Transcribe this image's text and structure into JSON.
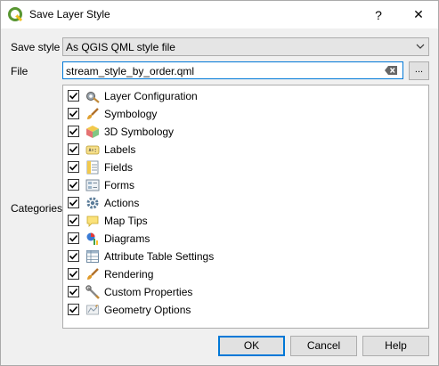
{
  "window": {
    "title": "Save Layer Style",
    "help_glyph": "?",
    "close_glyph": "✕"
  },
  "form": {
    "save_style_label": "Save style",
    "save_style_value": "As QGIS QML style file",
    "file_label": "File",
    "file_value": "stream_style_by_order.qml",
    "browse_label": "...",
    "categories_label": "Categories"
  },
  "categories": [
    {
      "label": "Layer Configuration",
      "checked": true,
      "icon": "layer-configuration-icon"
    },
    {
      "label": "Symbology",
      "checked": true,
      "icon": "symbology-icon"
    },
    {
      "label": "3D Symbology",
      "checked": true,
      "icon": "3d-symbology-icon"
    },
    {
      "label": "Labels",
      "checked": true,
      "icon": "labels-icon"
    },
    {
      "label": "Fields",
      "checked": true,
      "icon": "fields-icon"
    },
    {
      "label": "Forms",
      "checked": true,
      "icon": "forms-icon"
    },
    {
      "label": "Actions",
      "checked": true,
      "icon": "actions-icon"
    },
    {
      "label": "Map Tips",
      "checked": true,
      "icon": "map-tips-icon"
    },
    {
      "label": "Diagrams",
      "checked": true,
      "icon": "diagrams-icon"
    },
    {
      "label": "Attribute Table Settings",
      "checked": true,
      "icon": "attribute-table-icon"
    },
    {
      "label": "Rendering",
      "checked": true,
      "icon": "rendering-icon"
    },
    {
      "label": "Custom Properties",
      "checked": true,
      "icon": "custom-properties-icon"
    },
    {
      "label": "Geometry Options",
      "checked": true,
      "icon": "geometry-options-icon"
    }
  ],
  "buttons": {
    "ok": "OK",
    "cancel": "Cancel",
    "help": "Help"
  },
  "colors": {
    "focus_accent": "#0078d7",
    "qgis_green": "#589632"
  }
}
